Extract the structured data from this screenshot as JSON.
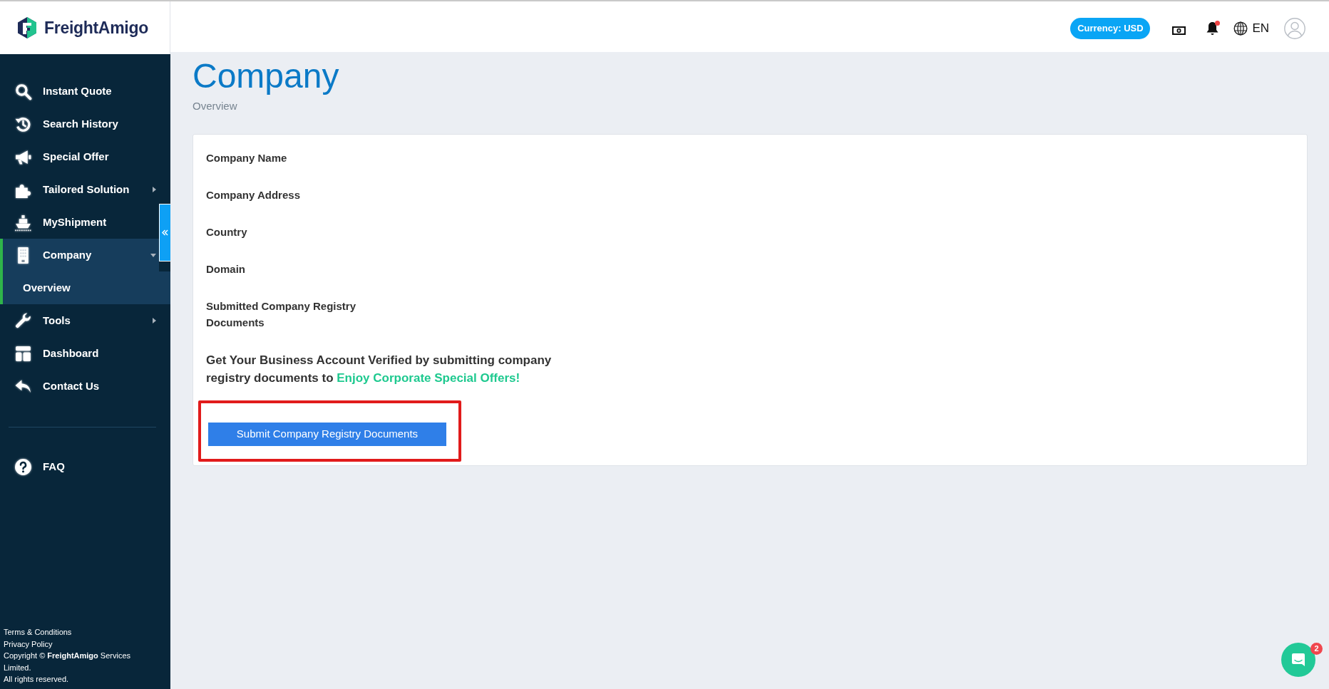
{
  "logo": {
    "text": "FreightAmigo"
  },
  "sidebar": {
    "items": [
      {
        "label": "Instant Quote",
        "kind": "link",
        "selected": false
      },
      {
        "label": "Search History",
        "kind": "link",
        "selected": false
      },
      {
        "label": "Special Offer",
        "kind": "link",
        "selected": false
      },
      {
        "label": "Tailored Solution",
        "kind": "group",
        "expanded": false,
        "selected": false
      },
      {
        "label": "MyShipment",
        "kind": "link",
        "selected": false
      },
      {
        "label": "Company",
        "kind": "group",
        "expanded": true,
        "selected": true,
        "children": [
          {
            "label": "Overview",
            "selected": true
          }
        ]
      },
      {
        "label": "Tools",
        "kind": "group",
        "expanded": false,
        "selected": false
      },
      {
        "label": "Dashboard",
        "kind": "link",
        "selected": false
      },
      {
        "label": "Contact Us",
        "kind": "link",
        "selected": false
      }
    ],
    "help_items": [
      {
        "label": "FAQ",
        "selected": false
      }
    ],
    "footer": {
      "links": [
        "Terms & Conditions",
        "Privacy Policy"
      ],
      "copyright": "Copyright © **FreightAmigo** Services Limited.",
      "rights": "All rights reserved."
    }
  },
  "topbar": {
    "currency": "Currency: USD",
    "notifications_unread": true,
    "language": "EN"
  },
  "page": {
    "title": "Company",
    "subtitle": "Overview"
  },
  "company_card": {
    "fields": [
      "Company Name",
      "Company Address",
      "Country",
      "Domain",
      "Submitted Company Registry Documents"
    ],
    "promo": {
      "text": "Get Your Business Account Verified by submitting company registry documents to",
      "highlight": "Enjoy Corporate Special Offers!"
    },
    "submit_button": {
      "label": "Submit Company Registry Documents",
      "highlighted": true
    }
  },
  "chat": {
    "badge": "2"
  }
}
